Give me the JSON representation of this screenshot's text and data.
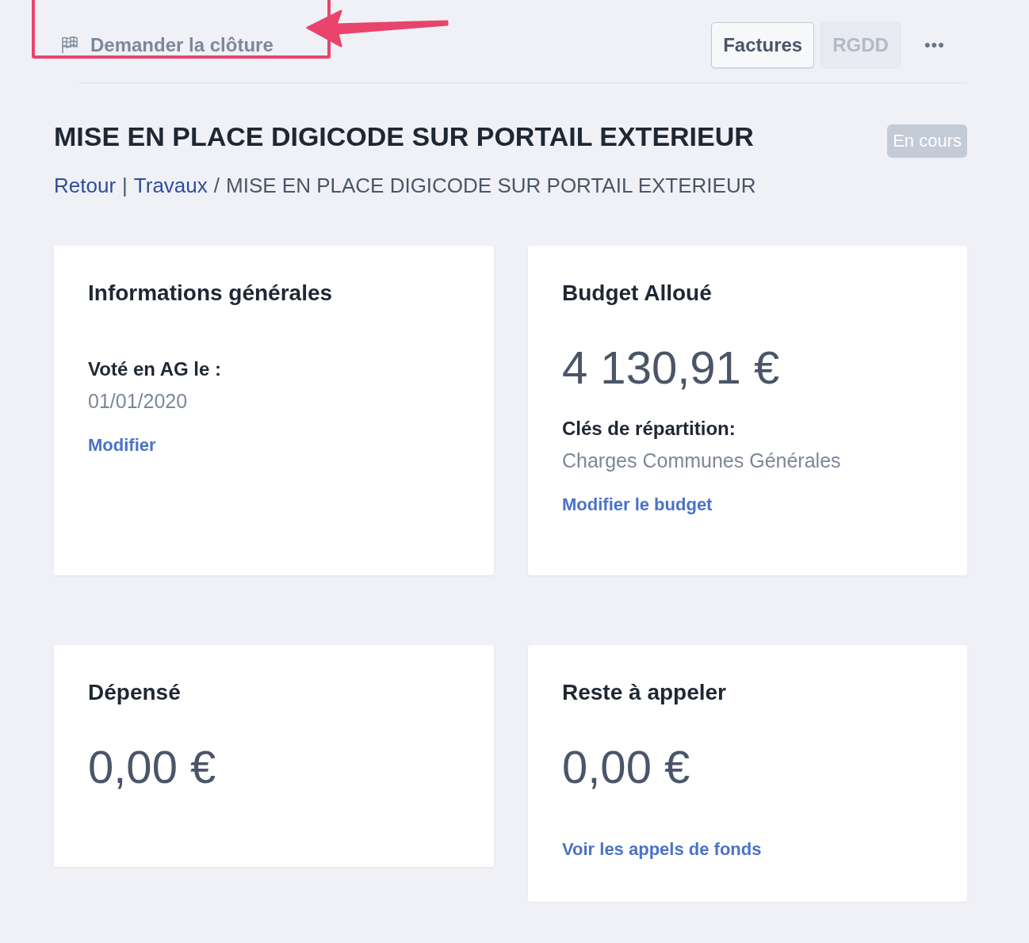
{
  "toolbar": {
    "close_request": {
      "label": "Demander la clôture"
    },
    "buttons": [
      {
        "label": "Factures",
        "disabled": false
      },
      {
        "label": "RGDD",
        "disabled": true
      }
    ],
    "more": "•••"
  },
  "header": {
    "title": "MISE EN PLACE DIGICODE SUR PORTAIL EXTERIEUR",
    "status": "En cours",
    "breadcrumb": [
      {
        "label": "Retour",
        "kind": "link",
        "sep": "|"
      },
      {
        "label": "Travaux",
        "kind": "link",
        "sep": "/"
      },
      {
        "label": "MISE EN PLACE DIGICODE SUR PORTAIL EXTERIEUR",
        "kind": "current"
      }
    ]
  },
  "cards": [
    {
      "title": "Informations générales",
      "items": [
        {
          "kind": "field",
          "label": "Voté en AG le :",
          "value": "01/01/2020"
        },
        {
          "kind": "link",
          "text": "Modifier"
        }
      ]
    },
    {
      "title": "Budget Alloué",
      "items": [
        {
          "kind": "amount",
          "text": "4 130,91 €"
        },
        {
          "kind": "field",
          "label": "Clés de répartition:",
          "value": "Charges Communes Générales"
        },
        {
          "kind": "link",
          "text": "Modifier le budget"
        }
      ]
    },
    {
      "title": "Dépensé",
      "items": [
        {
          "kind": "amount",
          "text": "0,00 €"
        }
      ]
    },
    {
      "title": "Reste à appeler",
      "items": [
        {
          "kind": "amount",
          "text": "0,00 €"
        },
        {
          "kind": "link",
          "text": "Voir les appels de fonds"
        }
      ]
    }
  ]
}
